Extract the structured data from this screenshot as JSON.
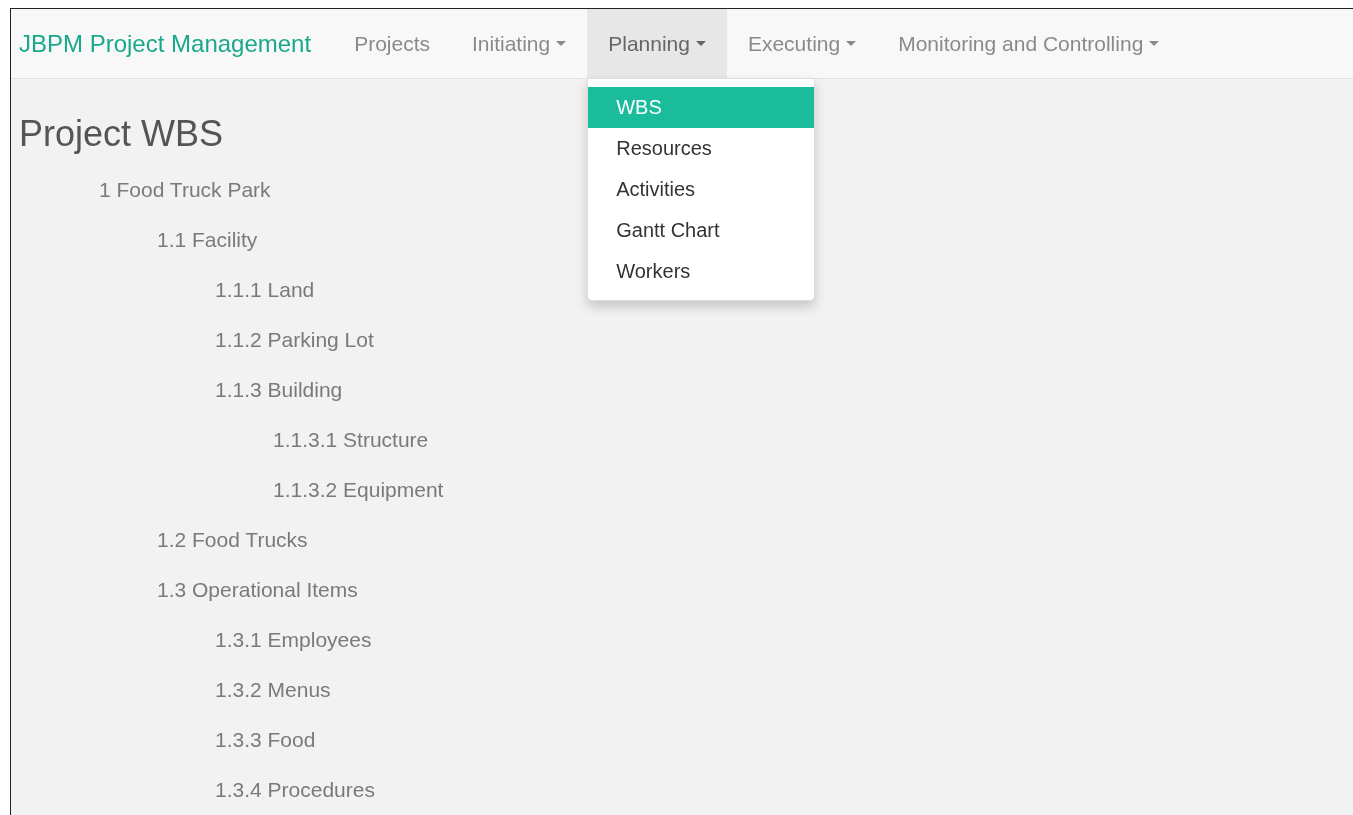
{
  "navbar": {
    "brand": "JBPM Project Management",
    "items": [
      {
        "label": "Projects",
        "dropdown": false,
        "selected": false
      },
      {
        "label": "Initiating",
        "dropdown": true,
        "selected": false
      },
      {
        "label": "Planning",
        "dropdown": true,
        "selected": true,
        "expanded": true
      },
      {
        "label": "Executing",
        "dropdown": true,
        "selected": false
      },
      {
        "label": "Monitoring and Controlling",
        "dropdown": true,
        "selected": false
      }
    ]
  },
  "dropdown_menu": {
    "items": [
      {
        "label": "WBS",
        "selected": true
      },
      {
        "label": "Resources",
        "selected": false
      },
      {
        "label": "Activities",
        "selected": false
      },
      {
        "label": "Gantt Chart",
        "selected": false
      },
      {
        "label": "Workers",
        "selected": false
      }
    ]
  },
  "page_title": "Project WBS",
  "wbs": [
    {
      "label": "1 Food Truck Park",
      "children": [
        {
          "label": "1.1 Facility",
          "children": [
            {
              "label": "1.1.1 Land"
            },
            {
              "label": "1.1.2 Parking Lot"
            },
            {
              "label": "1.1.3 Building",
              "children": [
                {
                  "label": "1.1.3.1 Structure"
                },
                {
                  "label": "1.1.3.2 Equipment"
                }
              ]
            }
          ]
        },
        {
          "label": "1.2 Food Trucks"
        },
        {
          "label": "1.3 Operational Items",
          "children": [
            {
              "label": "1.3.1 Employees"
            },
            {
              "label": "1.3.2 Menus"
            },
            {
              "label": "1.3.3 Food"
            },
            {
              "label": "1.3.4 Procedures"
            }
          ]
        }
      ]
    }
  ]
}
